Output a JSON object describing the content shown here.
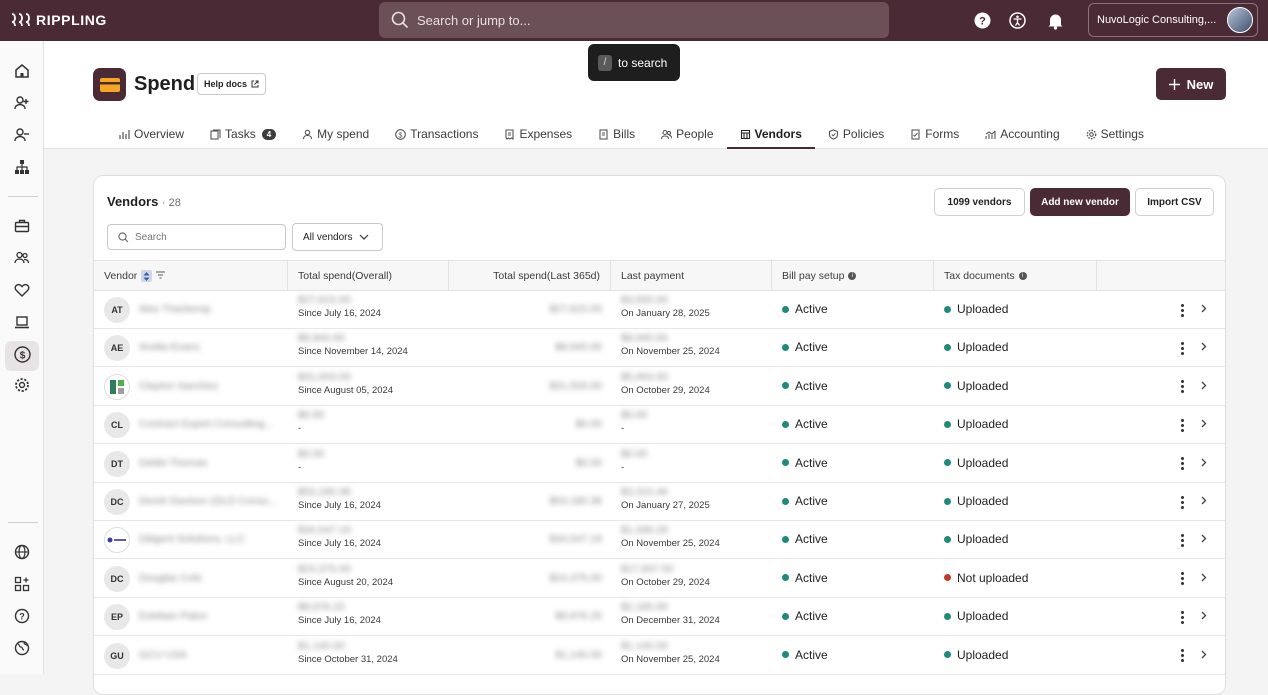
{
  "topbar": {
    "logo_text": "RIPPLING",
    "search_placeholder": "Search or jump to...",
    "company_name": "NuvoLogic Consulting,...",
    "icons": [
      "help-icon",
      "accessibility-icon",
      "bell-icon"
    ]
  },
  "tooltip": {
    "key": "/",
    "text": "to search"
  },
  "sidebar": {
    "icons": [
      "home-icon",
      "add-person-icon",
      "remove-person-icon",
      "org-chart-icon",
      "briefcase-icon",
      "people-icon",
      "heart-icon",
      "laptop-icon",
      "dollar-icon",
      "gear-icon",
      "globe-icon",
      "apps-icon",
      "help-icon",
      "world-icon"
    ],
    "active": "dollar-icon"
  },
  "header": {
    "title": "Spend",
    "help_docs": "Help docs",
    "new_button": "New"
  },
  "tabs": [
    {
      "label": "Overview",
      "icon": "chart-icon"
    },
    {
      "label": "Tasks",
      "icon": "tasks-icon",
      "badge": "4"
    },
    {
      "label": "My spend",
      "icon": "person-icon"
    },
    {
      "label": "Transactions",
      "icon": "dollar-icon"
    },
    {
      "label": "Expenses",
      "icon": "receipt-icon"
    },
    {
      "label": "Bills",
      "icon": "bill-icon"
    },
    {
      "label": "People",
      "icon": "people-icon"
    },
    {
      "label": "Vendors",
      "icon": "vendor-icon",
      "active": true
    },
    {
      "label": "Policies",
      "icon": "shield-icon"
    },
    {
      "label": "Forms",
      "icon": "form-icon"
    },
    {
      "label": "Accounting",
      "icon": "accounting-icon"
    },
    {
      "label": "Settings",
      "icon": "gear-icon"
    }
  ],
  "vendors": {
    "title": "Vendors",
    "count": "· 28",
    "btn_1099": "1099 vendors",
    "btn_add": "Add new vendor",
    "btn_import": "Import CSV",
    "search_placeholder": "Search",
    "filter_label": "All vendors",
    "columns": [
      "Vendor",
      "Total spend(Overall)",
      "Total spend(Last 365d)",
      "Last payment",
      "Bill pay setup",
      "Tax documents"
    ],
    "colors": {
      "active": "#1f8a7a",
      "uploaded": "#1f8a7a",
      "not_uploaded": "#c0392b"
    },
    "rows": [
      {
        "initials": "AT",
        "name": "Alex Thackeray",
        "overall": "$27,815.00",
        "since": "Since July 16, 2024",
        "last365": "$27,815.00",
        "last_payment": "$3,000.00",
        "on": "On January 28, 2025",
        "bill_pay": "Active",
        "tax": "Uploaded"
      },
      {
        "initials": "AE",
        "name": "Amilia Evans",
        "overall": "$8,940.00",
        "since": "Since November 14, 2024",
        "last365": "$8,940.00",
        "last_payment": "$8,940.00",
        "on": "On November 25, 2024",
        "bill_pay": "Active",
        "tax": "Uploaded"
      },
      {
        "initials": "",
        "name": "Clayton Sanchez",
        "overall": "$31,933.00",
        "since": "Since August 05, 2024",
        "last365": "$31,933.00",
        "last_payment": "$5,064.00",
        "on": "On October 29, 2024",
        "bill_pay": "Active",
        "tax": "Uploaded"
      },
      {
        "initials": "CL",
        "name": "Contract Expert Consulting...",
        "overall": "$0.00",
        "since": "-",
        "last365": "$0.00",
        "last_payment": "$0.00",
        "on": "-",
        "bill_pay": "Active",
        "tax": "Uploaded"
      },
      {
        "initials": "DT",
        "name": "Debbi Thomas",
        "overall": "$0.00",
        "since": "-",
        "last365": "$0.00",
        "last_payment": "$0.00",
        "on": "-",
        "bill_pay": "Active",
        "tax": "Uploaded"
      },
      {
        "initials": "DC",
        "name": "Derek Davison (DLD Consu...",
        "overall": "$53,180.38",
        "since": "Since July 16, 2024",
        "last365": "$53,180.38",
        "last_payment": "$3,315.46",
        "on": "On January 27, 2025",
        "bill_pay": "Active",
        "tax": "Uploaded"
      },
      {
        "initials": "",
        "name": "Diligent Solutions, LLC",
        "overall": "$34,547.19",
        "since": "Since July 16, 2024",
        "last365": "$34,547.19",
        "last_payment": "$1,338.28",
        "on": "On November 25, 2024",
        "bill_pay": "Active",
        "tax": "Uploaded"
      },
      {
        "initials": "DC",
        "name": "Douglas Cole",
        "overall": "$24,375.00",
        "since": "Since August 20, 2024",
        "last365": "$24,375.00",
        "last_payment": "$17,937.50",
        "on": "On October 29, 2024",
        "bill_pay": "Active",
        "tax": "Not uploaded"
      },
      {
        "initials": "EP",
        "name": "Esteban Palon",
        "overall": "$9,976.25",
        "since": "Since July 16, 2024",
        "last365": "$9,976.25",
        "last_payment": "$2,185.00",
        "on": "On December 31, 2024",
        "bill_pay": "Active",
        "tax": "Uploaded"
      },
      {
        "initials": "GU",
        "name": "GCU USA",
        "overall": "$1,140.00",
        "since": "Since October 31, 2024",
        "last365": "$1,140.00",
        "last_payment": "$1,140.00",
        "on": "On November 25, 2024",
        "bill_pay": "Active",
        "tax": "Uploaded"
      }
    ]
  }
}
